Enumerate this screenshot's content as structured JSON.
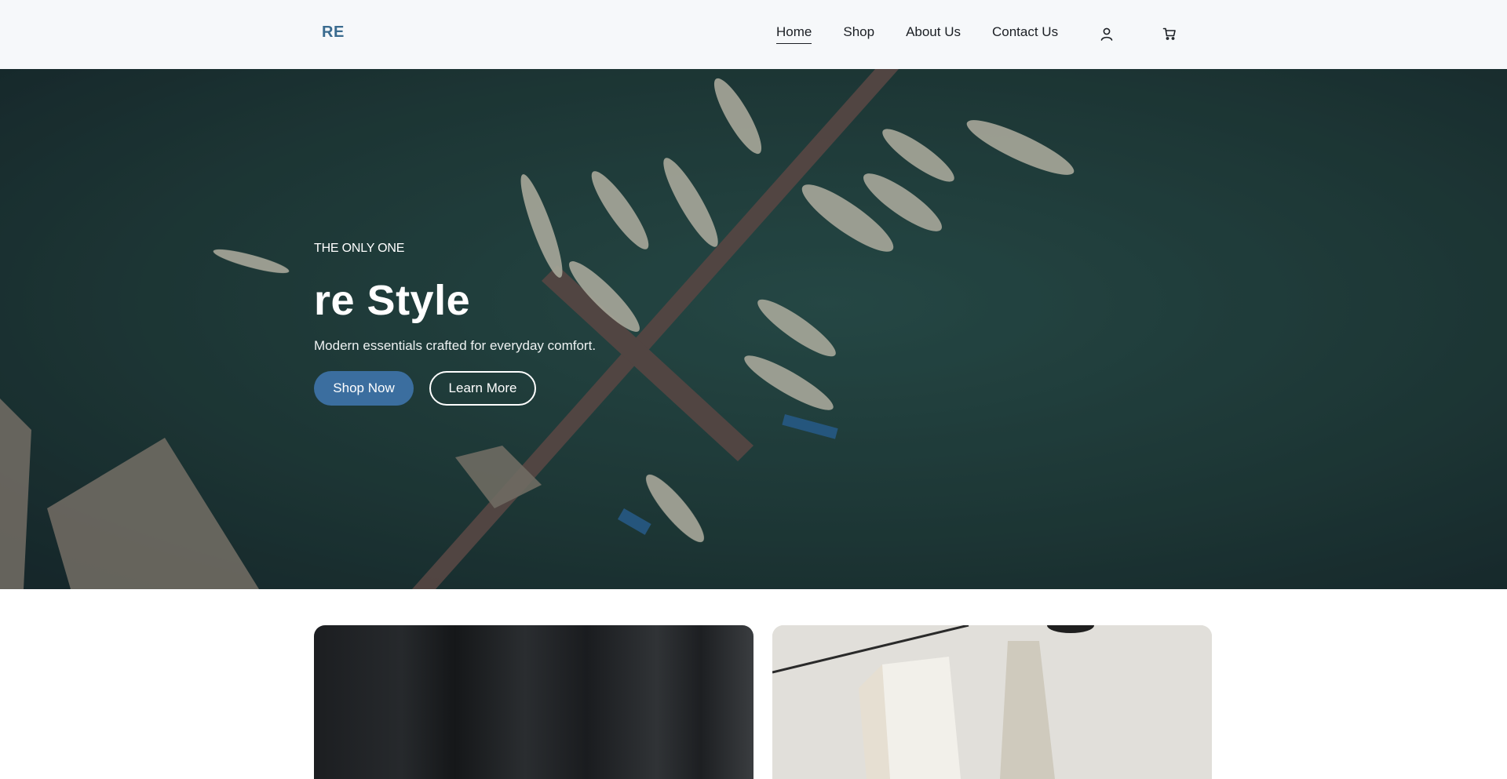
{
  "header": {
    "logo": "RE",
    "nav": [
      {
        "label": "Home",
        "active": true
      },
      {
        "label": "Shop",
        "active": false
      },
      {
        "label": "About Us",
        "active": false
      },
      {
        "label": "Contact Us",
        "active": false
      }
    ],
    "icons": [
      "user-icon",
      "cart-icon"
    ]
  },
  "hero": {
    "eyebrow": "THE ONLY ONE",
    "title": "re Style",
    "subtitle": "Modern essentials crafted for everyday comfort.",
    "primary_button": "Shop Now",
    "secondary_button": "Learn More",
    "image": "aerial-harbor-with-boats"
  },
  "cards": [
    {
      "image": "dark-curtain-fabric"
    },
    {
      "image": "clothes-on-hangers"
    }
  ],
  "colors": {
    "accent": "#3b6e9f",
    "logo": "#3a6b8f",
    "header_bg": "#f6f8fa",
    "water": "#23413f"
  }
}
